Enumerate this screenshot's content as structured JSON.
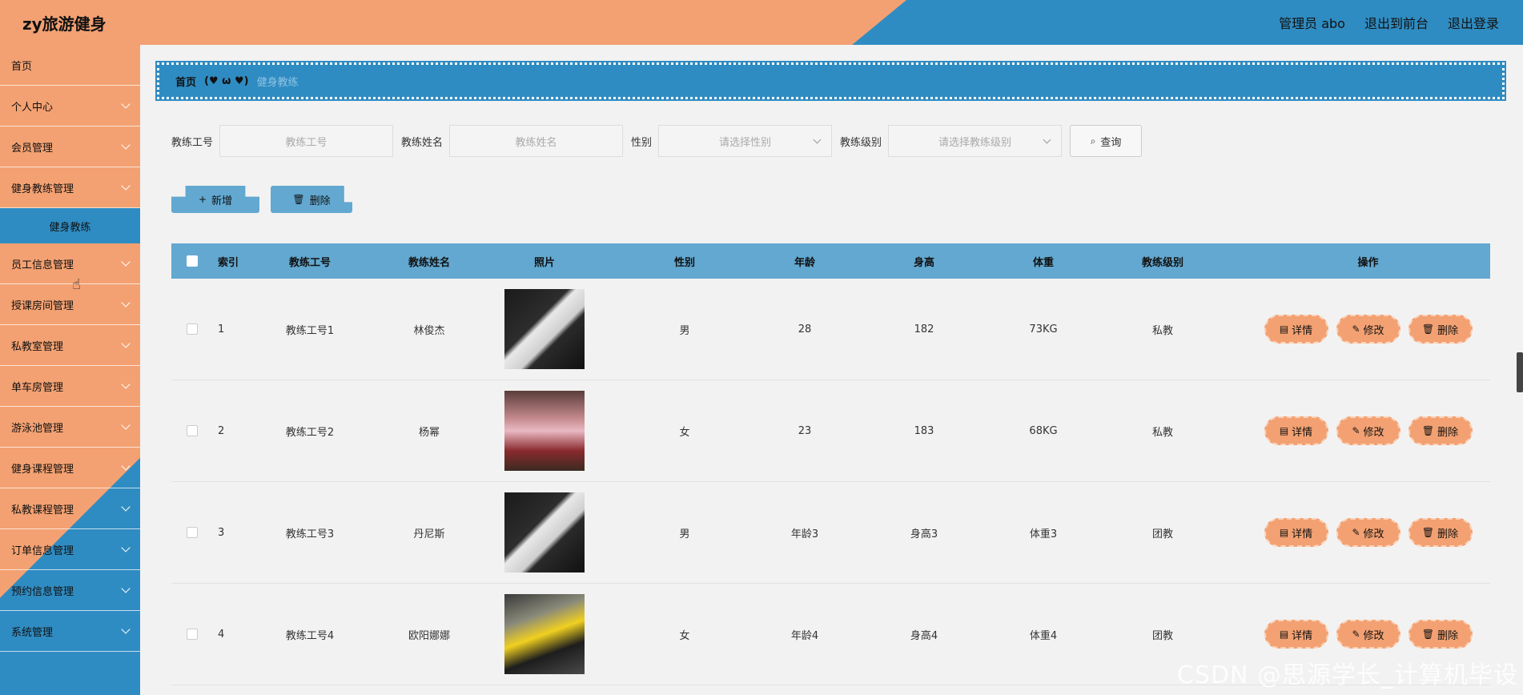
{
  "header": {
    "brand": "zy旅游健身",
    "admin_label": "管理员 abo",
    "back_front": "退出到前台",
    "logout": "退出登录"
  },
  "sidebar": {
    "items": [
      {
        "label": "首页",
        "has_children": false
      },
      {
        "label": "个人中心",
        "has_children": true
      },
      {
        "label": "会员管理",
        "has_children": true
      },
      {
        "label": "健身教练管理",
        "has_children": true
      },
      {
        "label": "健身教练",
        "sub": true,
        "active": true
      },
      {
        "label": "员工信息管理",
        "has_children": true
      },
      {
        "label": "授课房间管理",
        "has_children": true
      },
      {
        "label": "私教室管理",
        "has_children": true
      },
      {
        "label": "单车房管理",
        "has_children": true
      },
      {
        "label": "游泳池管理",
        "has_children": true
      },
      {
        "label": "健身课程管理",
        "has_children": true
      },
      {
        "label": "私教课程管理",
        "has_children": true
      },
      {
        "label": "订单信息管理",
        "has_children": true
      },
      {
        "label": "预约信息管理",
        "has_children": true
      },
      {
        "label": "系统管理",
        "has_children": true
      }
    ]
  },
  "breadcrumb": {
    "home": "首页",
    "separator": "(♥ ω ♥)",
    "current": "健身教练"
  },
  "search": {
    "no_label": "教练工号",
    "no_placeholder": "教练工号",
    "name_label": "教练姓名",
    "name_placeholder": "教练姓名",
    "sex_label": "性别",
    "sex_placeholder": "请选择性别",
    "level_label": "教练级别",
    "level_placeholder": "请选择教练级别",
    "query": "查询"
  },
  "actions": {
    "add": "新增",
    "delete": "删除"
  },
  "table": {
    "headers": [
      "索引",
      "教练工号",
      "教练姓名",
      "照片",
      "性别",
      "年龄",
      "身高",
      "体重",
      "教练级别",
      "操作"
    ],
    "rows": [
      {
        "index": "1",
        "no": "教练工号1",
        "name": "林俊杰",
        "sex": "男",
        "age": "28",
        "height": "182",
        "weight": "73KG",
        "level": "私教"
      },
      {
        "index": "2",
        "no": "教练工号2",
        "name": "杨幂",
        "sex": "女",
        "age": "23",
        "height": "183",
        "weight": "68KG",
        "level": "私教"
      },
      {
        "index": "3",
        "no": "教练工号3",
        "name": "丹尼斯",
        "sex": "男",
        "age": "年龄3",
        "height": "身高3",
        "weight": "体重3",
        "level": "团教"
      },
      {
        "index": "4",
        "no": "教练工号4",
        "name": "欧阳娜娜",
        "sex": "女",
        "age": "年龄4",
        "height": "身高4",
        "weight": "体重4",
        "level": "团教"
      }
    ],
    "ops": {
      "detail": "详情",
      "edit": "修改",
      "delete": "删除"
    }
  },
  "watermark": "CSDN @思源学长_计算机毕设",
  "colors": {
    "orange": "#f3a172",
    "blue": "#2f8cc2",
    "light_blue": "#62a8d0"
  }
}
